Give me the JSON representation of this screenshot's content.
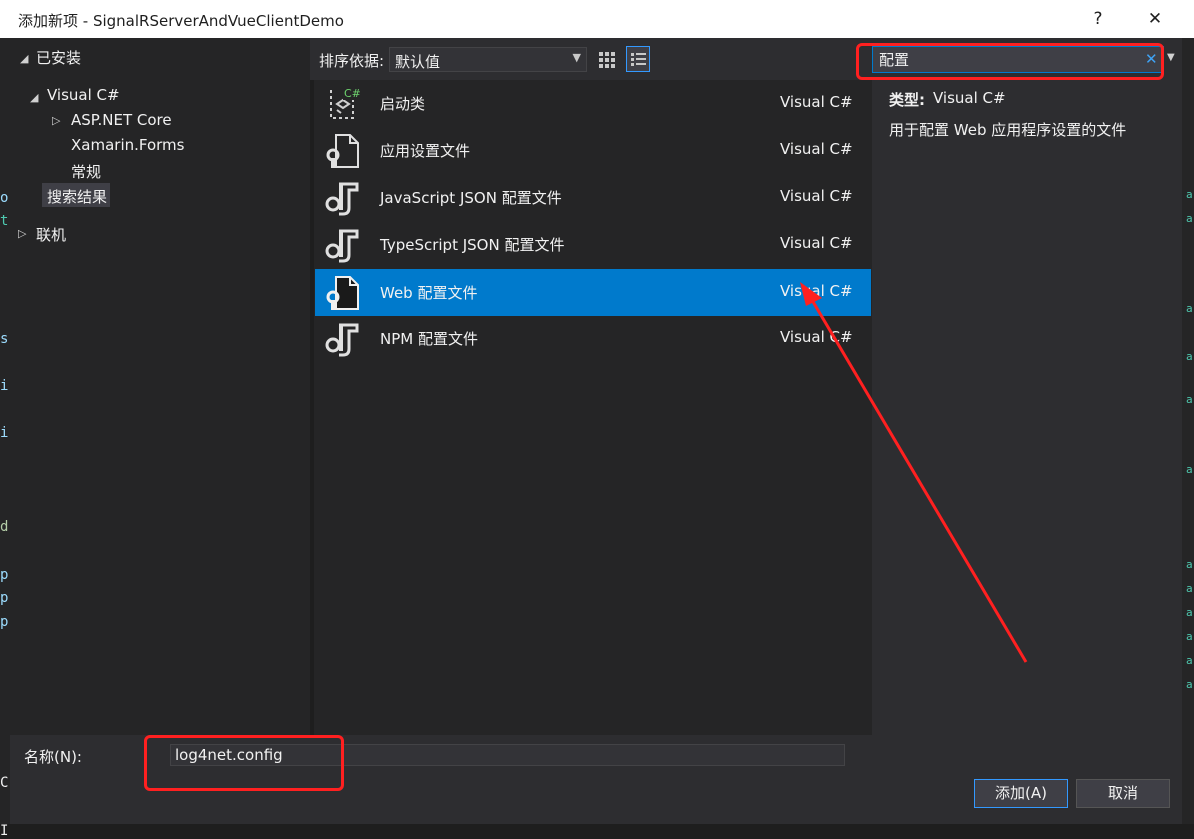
{
  "window": {
    "title": "添加新项 - SignalRServerAndVueClientDemo",
    "help_label": "?",
    "close_label": "✕"
  },
  "tree": {
    "installed": "已安装",
    "visual_csharp": "Visual C#",
    "aspnet_core": "ASP.NET Core",
    "xamarin_forms": "Xamarin.Forms",
    "general": "常规",
    "search_results": "搜索结果",
    "online": "联机"
  },
  "toolbar": {
    "sort_label": "排序依据:",
    "sort_value": "默认值"
  },
  "search": {
    "value": "配置"
  },
  "items": [
    {
      "name": "启动类",
      "type": "Visual C#",
      "icon": "startup-class-icon",
      "selected": false
    },
    {
      "name": "应用设置文件",
      "type": "Visual C#",
      "icon": "settings-file-icon",
      "selected": false
    },
    {
      "name": "JavaScript JSON 配置文件",
      "type": "Visual C#",
      "icon": "json-config-icon",
      "selected": false
    },
    {
      "name": "TypeScript JSON 配置文件",
      "type": "Visual C#",
      "icon": "json-config-icon",
      "selected": false
    },
    {
      "name": "Web 配置文件",
      "type": "Visual C#",
      "icon": "settings-file-icon",
      "selected": true
    },
    {
      "name": "NPM 配置文件",
      "type": "Visual C#",
      "icon": "json-config-icon",
      "selected": false
    }
  ],
  "details": {
    "type_label": "类型:",
    "type_value": "Visual C#",
    "description": "用于配置 Web 应用程序设置的文件"
  },
  "footer": {
    "name_label": "名称(N):",
    "name_value": "log4net.config",
    "add_button": "添加(A)",
    "cancel_button": "取消"
  },
  "colors": {
    "accent": "#007acc",
    "annotation": "#ff2020"
  }
}
